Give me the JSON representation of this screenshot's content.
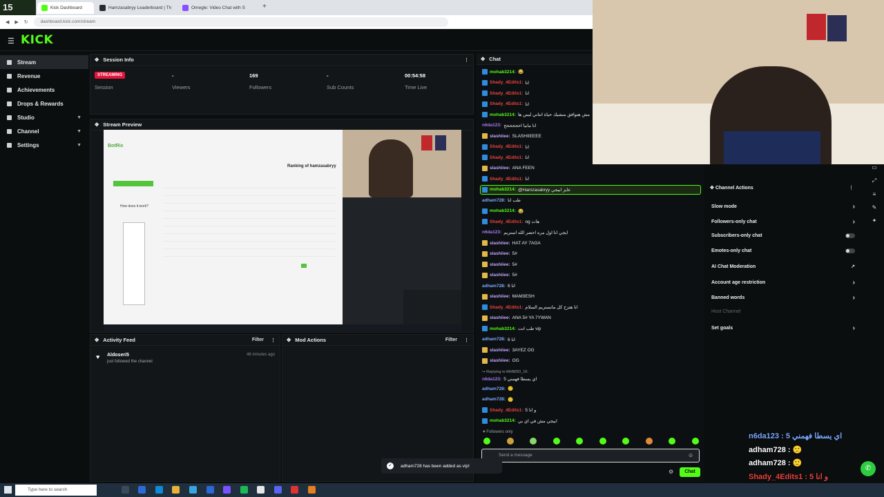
{
  "browser": {
    "tabs": [
      {
        "label": "Kick Dashboard",
        "color": "#53fc18"
      },
      {
        "label": "Hamzasabryy Leaderboard | Th",
        "color": "#2b2b2b"
      },
      {
        "label": "Omegle: Video Chat with S",
        "color": "#8a4fff"
      }
    ],
    "new_tab": "+",
    "url": "dashboard.kick.com/stream"
  },
  "logo": "KICK",
  "overlay_timer": "15",
  "sidebar": {
    "items": [
      {
        "label": "Stream",
        "active": true
      },
      {
        "label": "Revenue"
      },
      {
        "label": "Achievements"
      },
      {
        "label": "Drops & Rewards"
      },
      {
        "label": "Studio",
        "chevron": true
      },
      {
        "label": "Channel",
        "chevron": true
      },
      {
        "label": "Settings",
        "chevron": true
      }
    ]
  },
  "session": {
    "title": "Session Info",
    "status": "STREAMING",
    "status_label": "Session",
    "viewers_value": "-",
    "viewers_label": "Viewers",
    "followers_value": "169",
    "followers_label": "Followers",
    "subs_value": "-",
    "subs_label": "Sub Counts",
    "time_value": "00:54:58",
    "time_label": "Time Live"
  },
  "preview": {
    "title": "Stream Preview",
    "inner_brand": "BotRix",
    "inner_heading": "Ranking of hamzasabryy",
    "inner_button": "How does it work?"
  },
  "activity": {
    "title": "Activity Feed",
    "filter": "Filter",
    "user": "Aldoseri5",
    "action": "just followed the channel",
    "time": "48 minutes ago"
  },
  "mod": {
    "title": "Mod Actions",
    "filter": "Filter"
  },
  "chat": {
    "title": "Chat",
    "lines": [
      {
        "badge": "mod",
        "user": "mohab3214:",
        "cls": "u-green",
        "msg": "😂"
      },
      {
        "badge": "mod",
        "user": "Shady_4Edits1:",
        "cls": "u-red",
        "msg": "انا"
      },
      {
        "badge": "mod",
        "user": "Shady_4Edits1:",
        "cls": "u-red",
        "msg": "انا"
      },
      {
        "badge": "mod",
        "user": "Shady_4Edits1:",
        "cls": "u-red",
        "msg": "انا"
      },
      {
        "badge": "mod",
        "user": "mohab3214:",
        "cls": "u-green",
        "msg": "مش هتوافق منشيك حياة انتاني ليس ها"
      },
      {
        "badge": "",
        "user": "n6da123:",
        "cls": "u-purple",
        "msg": "انا مانيا احححححح"
      },
      {
        "badge": "vip",
        "user": "slashiiee:",
        "cls": "u-lilac",
        "msg": "SLASHIIEEEE"
      },
      {
        "badge": "mod",
        "user": "Shady_4Edits1:",
        "cls": "u-red",
        "msg": "انا"
      },
      {
        "badge": "mod",
        "user": "Shady_4Edits1:",
        "cls": "u-red",
        "msg": "انا"
      },
      {
        "badge": "vip",
        "user": "slashiiee:",
        "cls": "u-lilac",
        "msg": "ANA FEEN"
      },
      {
        "badge": "mod",
        "user": "Shady_4Edits1:",
        "cls": "u-red",
        "msg": "انا"
      },
      {
        "badge": "mod",
        "user": "mohab3214:",
        "cls": "u-green",
        "msg": "@Hamzasabryy عايز ابيجي",
        "highlight": true
      },
      {
        "badge": "",
        "user": "adham728:",
        "cls": "u-blue",
        "msg": "طب انا"
      },
      {
        "badge": "mod",
        "user": "mohab3214:",
        "cls": "u-green",
        "msg": "😂"
      },
      {
        "badge": "mod",
        "user": "Shady_4Edits1:",
        "cls": "u-red",
        "msg": "og هات"
      },
      {
        "badge": "",
        "user": "n6da123:",
        "cls": "u-purple",
        "msg": "ايجي انا اول مره احضر الله استريم"
      },
      {
        "badge": "vip",
        "user": "slashiiee:",
        "cls": "u-lilac",
        "msg": "HAT AY 7AGA"
      },
      {
        "badge": "vip",
        "user": "slashiiee:",
        "cls": "u-lilac",
        "msg": "5#"
      },
      {
        "badge": "vip",
        "user": "slashiiee:",
        "cls": "u-lilac",
        "msg": "5#"
      },
      {
        "badge": "vip",
        "user": "slashiiee:",
        "cls": "u-lilac",
        "msg": "5#"
      },
      {
        "badge": "",
        "user": "adham728:",
        "cls": "u-blue",
        "msg": "6 انا"
      },
      {
        "badge": "vip",
        "user": "slashiiee:",
        "cls": "u-lilac",
        "msg": "MAM3ESH"
      },
      {
        "badge": "mod",
        "user": "Shady_4Edits1:",
        "cls": "u-red",
        "msg": "انا هتزح كل مانستريم السلام"
      },
      {
        "badge": "vip",
        "user": "slashiiee:",
        "cls": "u-lilac",
        "msg": "ANA 5# YA 7YWAN"
      },
      {
        "badge": "mod",
        "user": "mohab3214:",
        "cls": "u-green",
        "msg": "طب انت vip"
      },
      {
        "badge": "",
        "user": "adham728:",
        "cls": "u-blue",
        "msg": "6 انا"
      },
      {
        "badge": "vip",
        "user": "slashiiee:",
        "cls": "u-lilac",
        "msg": "3AYEZ OG"
      },
      {
        "badge": "vip",
        "user": "slashiiee:",
        "cls": "u-lilac",
        "msg": "OG"
      }
    ],
    "reply_note": "↪ Replying to MHMDD_16:",
    "reply_line": {
      "user": "n6da123:",
      "msg": "اي يسطا فهمني 5"
    },
    "tail": [
      {
        "badge": "",
        "user": "adham728:",
        "cls": "u-blue",
        "msg": "🙂"
      },
      {
        "badge": "",
        "user": "adham728:",
        "cls": "u-blue",
        "msg": "🙂"
      },
      {
        "badge": "mod",
        "user": "Shady_4Edits1:",
        "cls": "u-red",
        "msg": "5 و انا"
      },
      {
        "badge": "mod",
        "user": "mohab3214:",
        "cls": "u-green",
        "msg": "ابيجي مش في اي بي"
      }
    ],
    "followers_only": "Followers only",
    "input_placeholder": "Send a message",
    "send_label": "Chat"
  },
  "toast": {
    "message": "adham728 has been added as vip!"
  },
  "channel_actions": {
    "title": "Channel Actions",
    "items": [
      {
        "label": "Slow mode",
        "kind": "chevron"
      },
      {
        "label": "Followers-only chat",
        "kind": "chevron"
      },
      {
        "label": "Subscribers-only chat",
        "kind": "toggle"
      },
      {
        "label": "Emotes-only chat",
        "kind": "toggle"
      },
      {
        "label": "AI Chat Moderation",
        "kind": "link"
      },
      {
        "label": "Account age restriction",
        "kind": "chevron"
      },
      {
        "label": "Banned words",
        "kind": "chevron"
      },
      {
        "label": "Host Channel",
        "kind": "disabled"
      },
      {
        "label": "Set goals",
        "kind": "chevron"
      }
    ]
  },
  "overlay_chat": [
    {
      "text": "n6da123 : اي يسطا فهمني 5",
      "color": "#7ca9ff"
    },
    {
      "text": "adham728 : 🙂",
      "color": "#ffffff"
    },
    {
      "text": "adham728 : 🙂",
      "color": "#ffffff"
    },
    {
      "text": "Shady_4Edits1 : 5 و انا",
      "color": "#e8433f"
    },
    {
      "text": "mohab3214 : ابيجي مش في اي بي",
      "color": "#53fc18"
    }
  ],
  "taskbar": {
    "search_placeholder": "Type here to search"
  }
}
